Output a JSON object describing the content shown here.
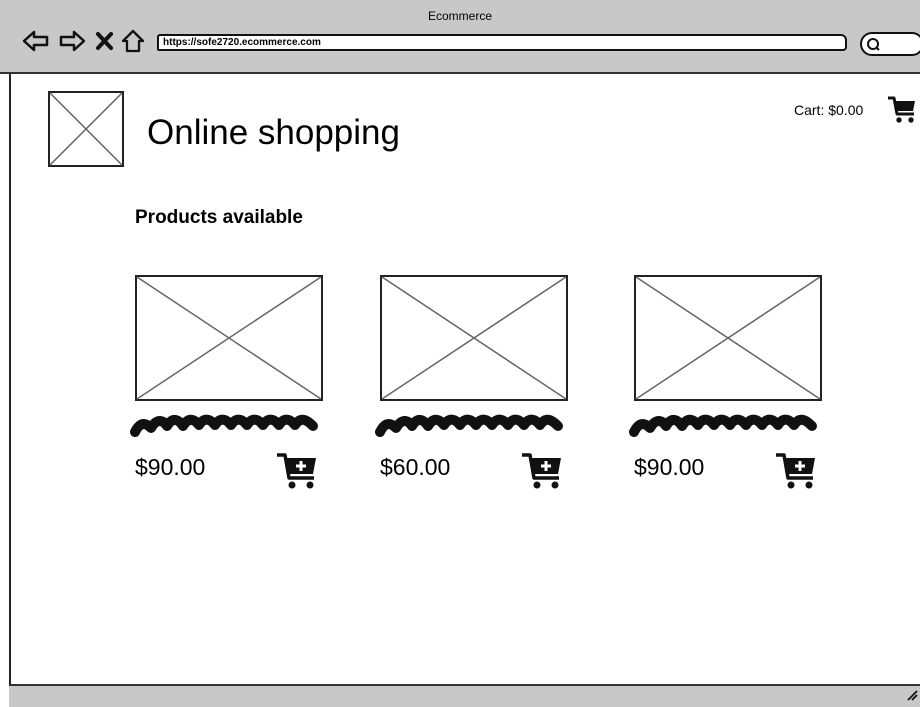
{
  "browser": {
    "window_title": "Ecommerce",
    "url": "https://sofe2720.ecommerce.com",
    "icons": [
      "back-icon",
      "forward-icon",
      "close-icon",
      "home-icon",
      "search-icon"
    ]
  },
  "header": {
    "title": "Online shopping",
    "cart_label": "Cart: $0.00"
  },
  "products_section": {
    "heading": "Products available",
    "products": [
      {
        "price": "$90.00"
      },
      {
        "price": "$60.00"
      },
      {
        "price": "$90.00"
      }
    ]
  },
  "colors": {
    "chrome": "#c8c8c8",
    "ink": "#111111",
    "placeholder": "#555555"
  }
}
